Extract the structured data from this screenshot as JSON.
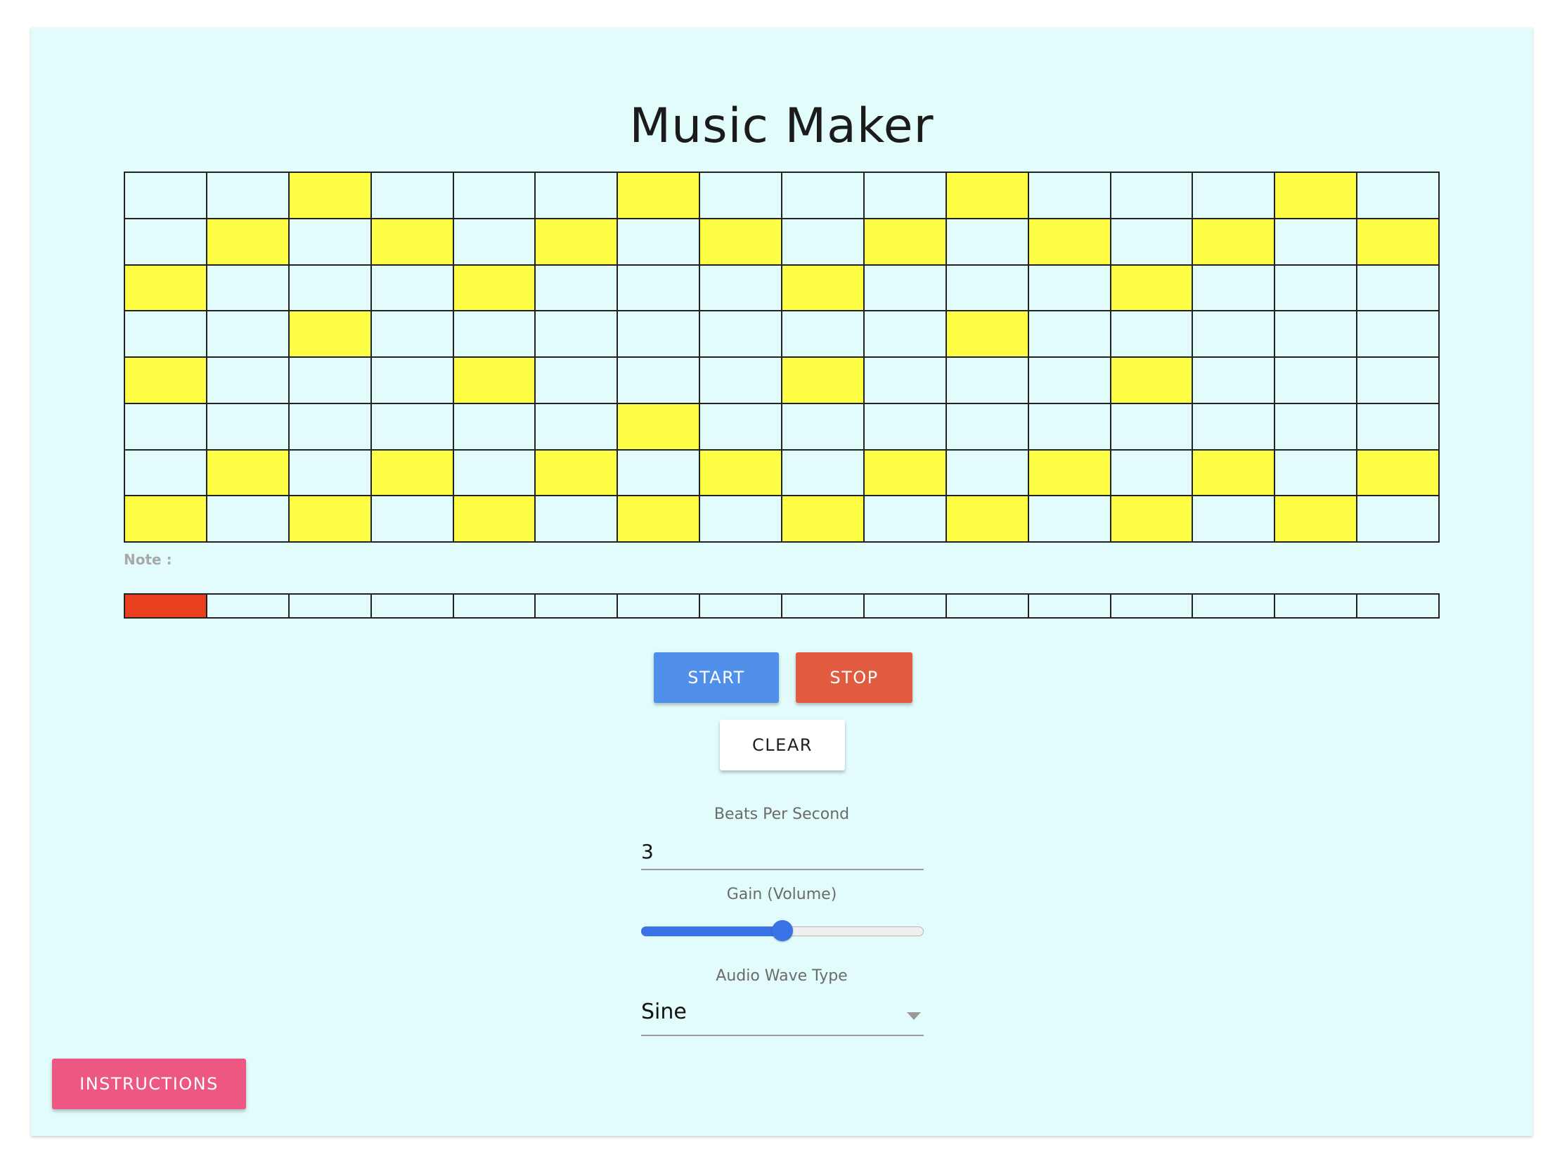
{
  "app": {
    "title": "Music Maker"
  },
  "colors": {
    "background": "#e2fcfc",
    "active_cell": "#fefe45",
    "playhead": "#e8401e",
    "start_button": "#5090ea",
    "stop_button": "#e05b40",
    "instructions_button": "#ec5882",
    "slider_accent": "#3a73e6"
  },
  "sequencer": {
    "rows": 8,
    "columns": 16,
    "active": [
      [
        0,
        0,
        1,
        0,
        0,
        0,
        1,
        0,
        0,
        0,
        1,
        0,
        0,
        0,
        1,
        0
      ],
      [
        0,
        1,
        0,
        1,
        0,
        1,
        0,
        1,
        0,
        1,
        0,
        1,
        0,
        1,
        0,
        1
      ],
      [
        1,
        0,
        0,
        0,
        1,
        0,
        0,
        0,
        1,
        0,
        0,
        0,
        1,
        0,
        0,
        0
      ],
      [
        0,
        0,
        1,
        0,
        0,
        0,
        0,
        0,
        0,
        0,
        1,
        0,
        0,
        0,
        0,
        0
      ],
      [
        1,
        0,
        0,
        0,
        1,
        0,
        0,
        0,
        1,
        0,
        0,
        0,
        1,
        0,
        0,
        0
      ],
      [
        0,
        0,
        0,
        0,
        0,
        0,
        1,
        0,
        0,
        0,
        0,
        0,
        0,
        0,
        0,
        0
      ],
      [
        0,
        1,
        0,
        1,
        0,
        1,
        0,
        1,
        0,
        1,
        0,
        1,
        0,
        1,
        0,
        1
      ],
      [
        1,
        0,
        1,
        0,
        1,
        0,
        1,
        0,
        1,
        0,
        1,
        0,
        1,
        0,
        1,
        0
      ]
    ]
  },
  "note": {
    "label": "Note :",
    "value": ""
  },
  "playhead": {
    "steps": 16,
    "current_step": 0
  },
  "controls": {
    "start_label": "START",
    "stop_label": "STOP",
    "clear_label": "CLEAR",
    "instructions_label": "INSTRUCTIONS"
  },
  "settings": {
    "bps_label": "Beats Per Second",
    "bps_value": "3",
    "gain_label": "Gain (Volume)",
    "gain_value": 0.5,
    "wave_label": "Audio Wave Type",
    "wave_value": "Sine"
  },
  "icons": {
    "select_caret": "chevron-down-icon"
  }
}
